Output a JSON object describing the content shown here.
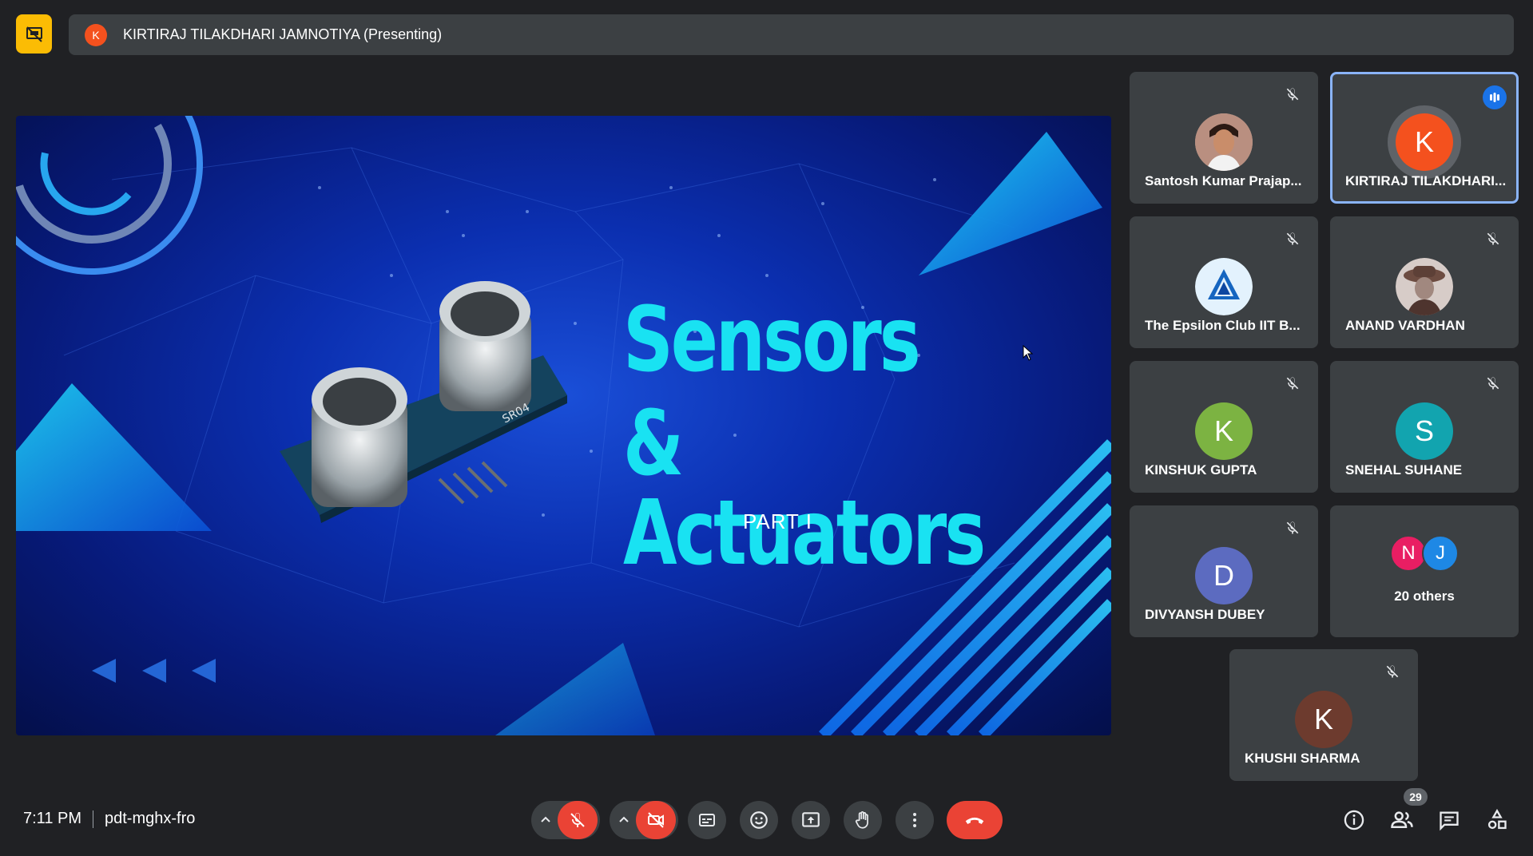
{
  "header": {
    "presenter_initial": "K",
    "presenter_text": "KIRTIRAJ TILAKDHARI JAMNOTIYA (Presenting)"
  },
  "slide": {
    "title_line1": "Sensors",
    "title_line2": "& Actuators",
    "subtitle": "PART I",
    "module_label": "SR04"
  },
  "participants": [
    {
      "name": "Santosh Kumar Prajap...",
      "initial": "",
      "color": "#8d6e63",
      "muted": true,
      "photo": "person-photo"
    },
    {
      "name": "KIRTIRAJ TILAKDHARI...",
      "initial": "K",
      "color": "#f4511e",
      "muted": false,
      "speaking": true
    },
    {
      "name": "The Epsilon Club IIT B...",
      "initial": "",
      "color": "#e3f2fd",
      "muted": true,
      "photo": "club-logo"
    },
    {
      "name": "ANAND VARDHAN",
      "initial": "",
      "color": "#6d4c41",
      "muted": true,
      "photo": "person-hat-photo"
    },
    {
      "name": "KINSHUK GUPTA",
      "initial": "K",
      "color": "#7cb342",
      "muted": true
    },
    {
      "name": "SNEHAL SUHANE",
      "initial": "S",
      "color": "#12a4af",
      "muted": true
    },
    {
      "name": "DIVYANSH DUBEY",
      "initial": "D",
      "color": "#5c6bc0",
      "muted": true
    },
    {
      "name": "KHUSHI SHARMA",
      "initial": "K",
      "color": "#6d3b2e",
      "muted": true
    }
  ],
  "others": {
    "initials": [
      "N",
      "J"
    ],
    "colors": [
      "#e91e63",
      "#1e88e5"
    ],
    "label": "20 others"
  },
  "footer": {
    "time": "7:11 PM",
    "meeting_code": "pdt-mghx-fro",
    "participant_count": "29"
  },
  "colors": {
    "background": "#202124",
    "tile": "#3c4043",
    "danger": "#ea4335",
    "accent": "#8ab4f8",
    "highlight": "#fbbc04"
  },
  "icons": [
    "present-off-icon",
    "mic-off-icon",
    "camera-off-icon",
    "captions-icon",
    "emoji-icon",
    "present-screen-icon",
    "raise-hand-icon",
    "more-options-icon",
    "end-call-icon",
    "info-icon",
    "people-icon",
    "chat-icon",
    "activities-icon"
  ]
}
